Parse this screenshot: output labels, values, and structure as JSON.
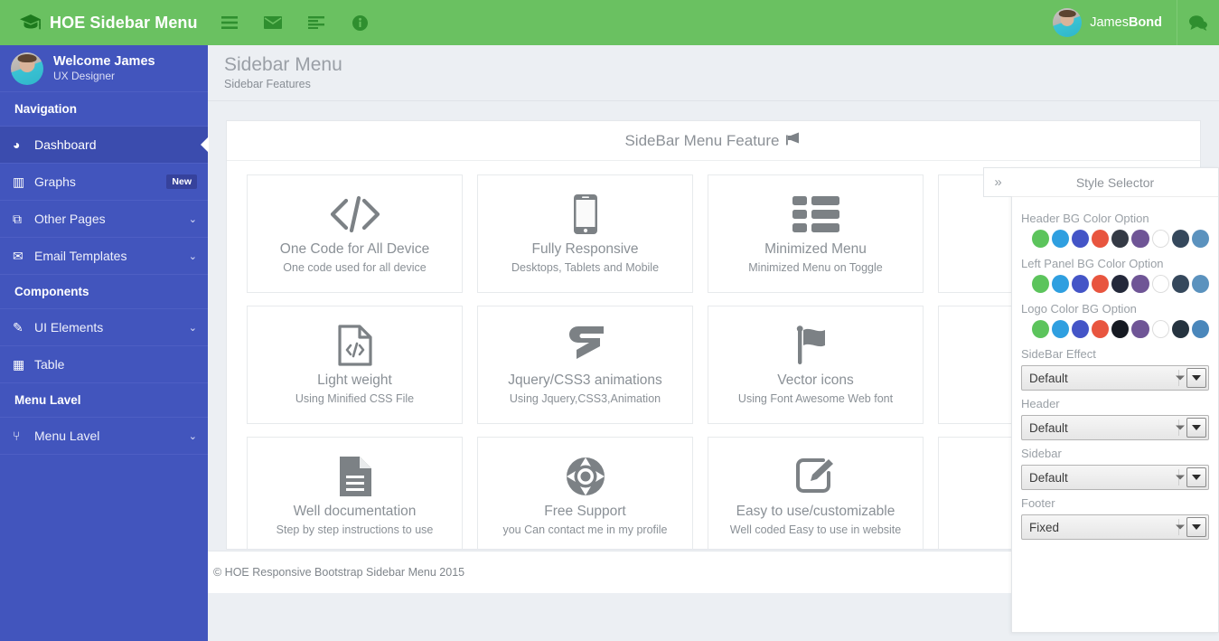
{
  "brand": {
    "logo_icon": "graduation-cap-icon",
    "title": "HOE Sidebar Menu"
  },
  "profile": {
    "name": "Welcome James",
    "role": "UX Designer"
  },
  "sidebar": {
    "sections": [
      {
        "header": "Navigation",
        "items": [
          {
            "label": "Dashboard",
            "icon": "dashboard-icon",
            "glyph": "◕",
            "active": true,
            "badge": "",
            "caret": false
          },
          {
            "label": "Graphs",
            "icon": "bar-chart-icon",
            "glyph": "▥",
            "active": false,
            "badge": "New",
            "caret": false
          },
          {
            "label": "Other Pages",
            "icon": "copy-icon",
            "glyph": "⧉",
            "active": false,
            "badge": "",
            "caret": true
          },
          {
            "label": "Email Templates",
            "icon": "envelope-icon",
            "glyph": "✉",
            "active": false,
            "badge": "",
            "caret": true
          }
        ]
      },
      {
        "header": "Components",
        "items": [
          {
            "label": "UI Elements",
            "icon": "edit-square-icon",
            "glyph": "✎",
            "active": false,
            "badge": "",
            "caret": true
          },
          {
            "label": "Table",
            "icon": "table-icon",
            "glyph": "▦",
            "active": false,
            "badge": "",
            "caret": false
          }
        ]
      },
      {
        "header": "Menu Lavel",
        "items": [
          {
            "label": "Menu Lavel",
            "icon": "sitemap-icon",
            "glyph": "⑂",
            "active": false,
            "badge": "",
            "caret": true
          }
        ]
      }
    ]
  },
  "topbar": {
    "icons": [
      {
        "name": "hamburger-menu-icon",
        "glyph": "☰"
      },
      {
        "name": "envelope-icon",
        "glyph": "✉"
      },
      {
        "name": "align-left-icon",
        "glyph": "▤"
      },
      {
        "name": "info-circle-icon",
        "glyph": "ⓘ"
      }
    ],
    "user": {
      "first": "James",
      "last": "Bond"
    },
    "chat_icon": "chat-bubble-icon",
    "chat_glyph": "💬"
  },
  "page": {
    "title": "Sidebar Menu",
    "subtitle": "Sidebar Features"
  },
  "panel": {
    "title": "SideBar Menu Feature",
    "title_icon": "bullhorn-icon",
    "title_glyph": "📣"
  },
  "cards": [
    {
      "icon": "code-icon",
      "title": "One Code for All Device",
      "sub": "One code used for all device"
    },
    {
      "icon": "mobile-phone-icon",
      "title": "Fully Responsive",
      "sub": "Desktops, Tablets and Mobile"
    },
    {
      "icon": "list-blocks-icon",
      "title": "Minimized Menu",
      "sub": "Minimized Menu on Toggle"
    },
    {
      "icon": "hidden-card-icon",
      "title": "",
      "sub": ""
    },
    {
      "icon": "file-code-icon",
      "title": "Light weight",
      "sub": "Using Minified CSS File"
    },
    {
      "icon": "css3-icon",
      "title": "Jquery/CSS3 animations",
      "sub": "Using Jquery,CSS3,Animation"
    },
    {
      "icon": "flag-icon",
      "title": "Vector icons",
      "sub": "Using Font Awesome Web font"
    },
    {
      "icon": "hidden-card-icon",
      "title": "",
      "sub": ""
    },
    {
      "icon": "file-text-icon",
      "title": "Well documentation",
      "sub": "Step by step instructions to use"
    },
    {
      "icon": "life-ring-icon",
      "title": "Free Support",
      "sub": "you Can contact me in my profile"
    },
    {
      "icon": "pencil-square-icon",
      "title": "Easy to use/customizable",
      "sub": "Well coded Easy to use in website"
    },
    {
      "icon": "hidden-card-icon",
      "title": "",
      "sub": ""
    }
  ],
  "footer": {
    "text": "© HOE Responsive Bootstrap Sidebar Menu 2015"
  },
  "style_selector": {
    "toggle_icon": "double-chevron-right-icon",
    "toggle_glyph": "»",
    "title": "Style Selector",
    "color_groups": [
      {
        "label": "Header BG Color Option",
        "colors": [
          "#5cc45c",
          "#2f9fe0",
          "#4455c7",
          "#e8553f",
          "#343a45",
          "#6f5596",
          "#ffffff",
          "#35485c",
          "#5b92be"
        ]
      },
      {
        "label": "Left Panel BG Color Option",
        "colors": [
          "#5cc45c",
          "#2f9fe0",
          "#4455c7",
          "#e8553f",
          "#23283a",
          "#6f5596",
          "#ffffff",
          "#35485c",
          "#5b92be"
        ]
      },
      {
        "label": "Logo Color BG Option",
        "colors": [
          "#5cc45c",
          "#2f9fe0",
          "#4455c7",
          "#e8553f",
          "#161a22",
          "#6f5596",
          "#ffffff",
          "#25333f",
          "#4a87bb"
        ]
      }
    ],
    "selects": [
      {
        "label": "SideBar Effect",
        "value": "Default"
      },
      {
        "label": "Header",
        "value": "Default"
      },
      {
        "label": "Sidebar",
        "value": "Default"
      },
      {
        "label": "Footer",
        "value": "Fixed"
      }
    ]
  }
}
